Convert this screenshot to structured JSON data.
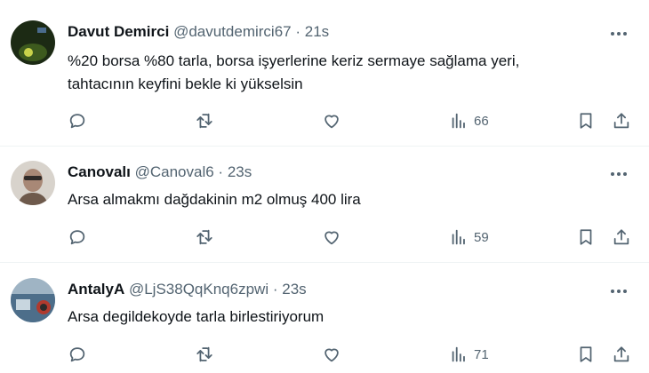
{
  "tweets": [
    {
      "name": "Davut Demirci",
      "handle": "@davutdemirci67",
      "separator": "·",
      "time": "21s",
      "text_lines": [
        "%20 borsa %80 tarla, borsa işyerlerine keriz sermaye sağlama yeri,",
        "tahtacının keyfini bekle ki yükselsin"
      ],
      "views": "66",
      "avatar_colors": [
        "#1c2a14",
        "#3d5a1e",
        "#c9d24a"
      ]
    },
    {
      "name": "Canovalı",
      "handle": "@Canoval6",
      "separator": "·",
      "time": "23s",
      "text_lines": [
        "Arsa almakmı dağdakinin m2 olmuş 400 lira"
      ],
      "views": "59",
      "avatar_colors": [
        "#d8d3cc",
        "#6e5a4c",
        "#2f2a28"
      ]
    },
    {
      "name": "AntalyA",
      "handle": "@LjS38QqKnq6zpwi",
      "separator": "·",
      "time": "23s",
      "text_lines": [
        "Arsa degildekoyde tarla birlestiriyorum"
      ],
      "views": "71",
      "avatar_colors": [
        "#4d6e8a",
        "#9fb4c4",
        "#b03a2e"
      ]
    }
  ],
  "icons": {
    "reply": "reply-icon",
    "retweet": "retweet-icon",
    "like": "like-icon",
    "views": "views-icon",
    "bookmark": "bookmark-icon",
    "share": "share-icon",
    "more": "more-icon"
  },
  "colors": {
    "text": "#0f1419",
    "secondary": "#536471",
    "divider": "#eff3f4"
  }
}
